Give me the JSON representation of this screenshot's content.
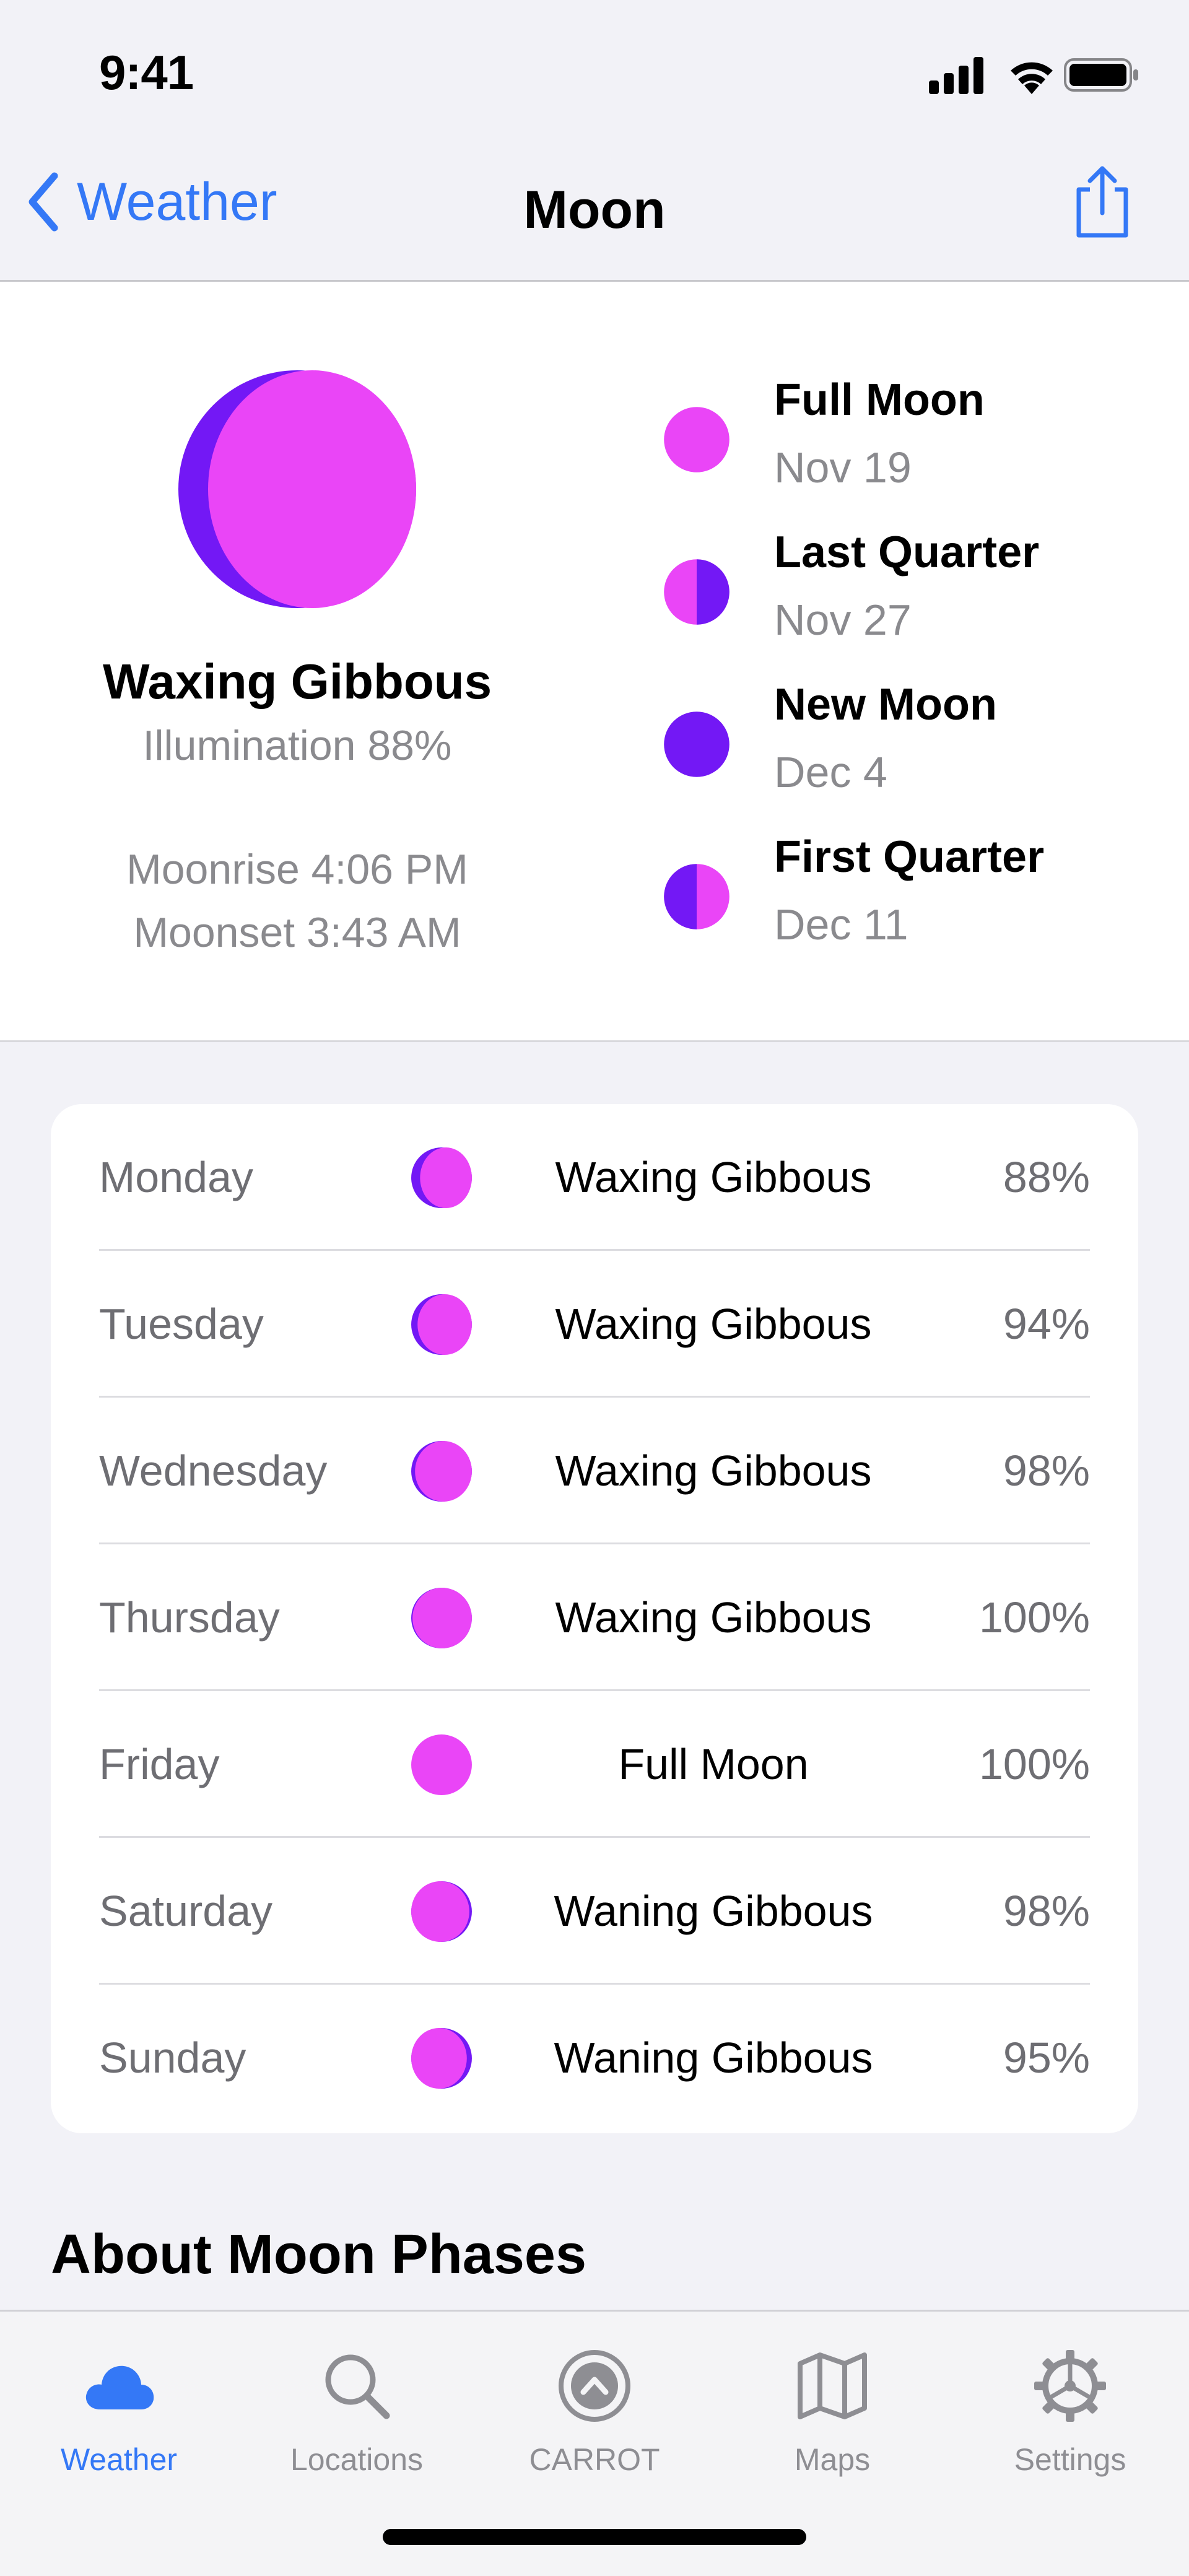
{
  "status_bar": {
    "time": "9:41"
  },
  "nav": {
    "back_label": "Weather",
    "title": "Moon"
  },
  "current": {
    "phase": "Waxing Gibbous",
    "illumination": "Illumination 88%",
    "moonrise": "Moonrise 4:06 PM",
    "moonset": "Moonset 3:43 AM"
  },
  "upcoming_phases": [
    {
      "name": "Full Moon",
      "date": "Nov 19"
    },
    {
      "name": "Last Quarter",
      "date": "Nov 27"
    },
    {
      "name": "New Moon",
      "date": "Dec 4"
    },
    {
      "name": "First Quarter",
      "date": "Dec 11"
    }
  ],
  "forecast": [
    {
      "day": "Monday",
      "phase": "Waxing Gibbous",
      "illumination": "88%"
    },
    {
      "day": "Tuesday",
      "phase": "Waxing Gibbous",
      "illumination": "94%"
    },
    {
      "day": "Wednesday",
      "phase": "Waxing Gibbous",
      "illumination": "98%"
    },
    {
      "day": "Thursday",
      "phase": "Waxing Gibbous",
      "illumination": "100%"
    },
    {
      "day": "Friday",
      "phase": "Full Moon",
      "illumination": "100%"
    },
    {
      "day": "Saturday",
      "phase": "Waning Gibbous",
      "illumination": "98%"
    },
    {
      "day": "Sunday",
      "phase": "Waning Gibbous",
      "illumination": "95%"
    }
  ],
  "section_heading": "About Moon Phases",
  "tabs": [
    {
      "label": "Weather",
      "icon": "cloud-icon",
      "active": true
    },
    {
      "label": "Locations",
      "icon": "search-icon",
      "active": false
    },
    {
      "label": "CARROT",
      "icon": "carrot-logo-icon",
      "active": false
    },
    {
      "label": "Maps",
      "icon": "map-icon",
      "active": false
    },
    {
      "label": "Settings",
      "icon": "gear-icon",
      "active": false
    }
  ],
  "colors": {
    "accent": "#3478f6",
    "moon_lit": "#ea45f7",
    "moon_dark": "#7318f5",
    "secondary_text": "#8a8a8e"
  }
}
